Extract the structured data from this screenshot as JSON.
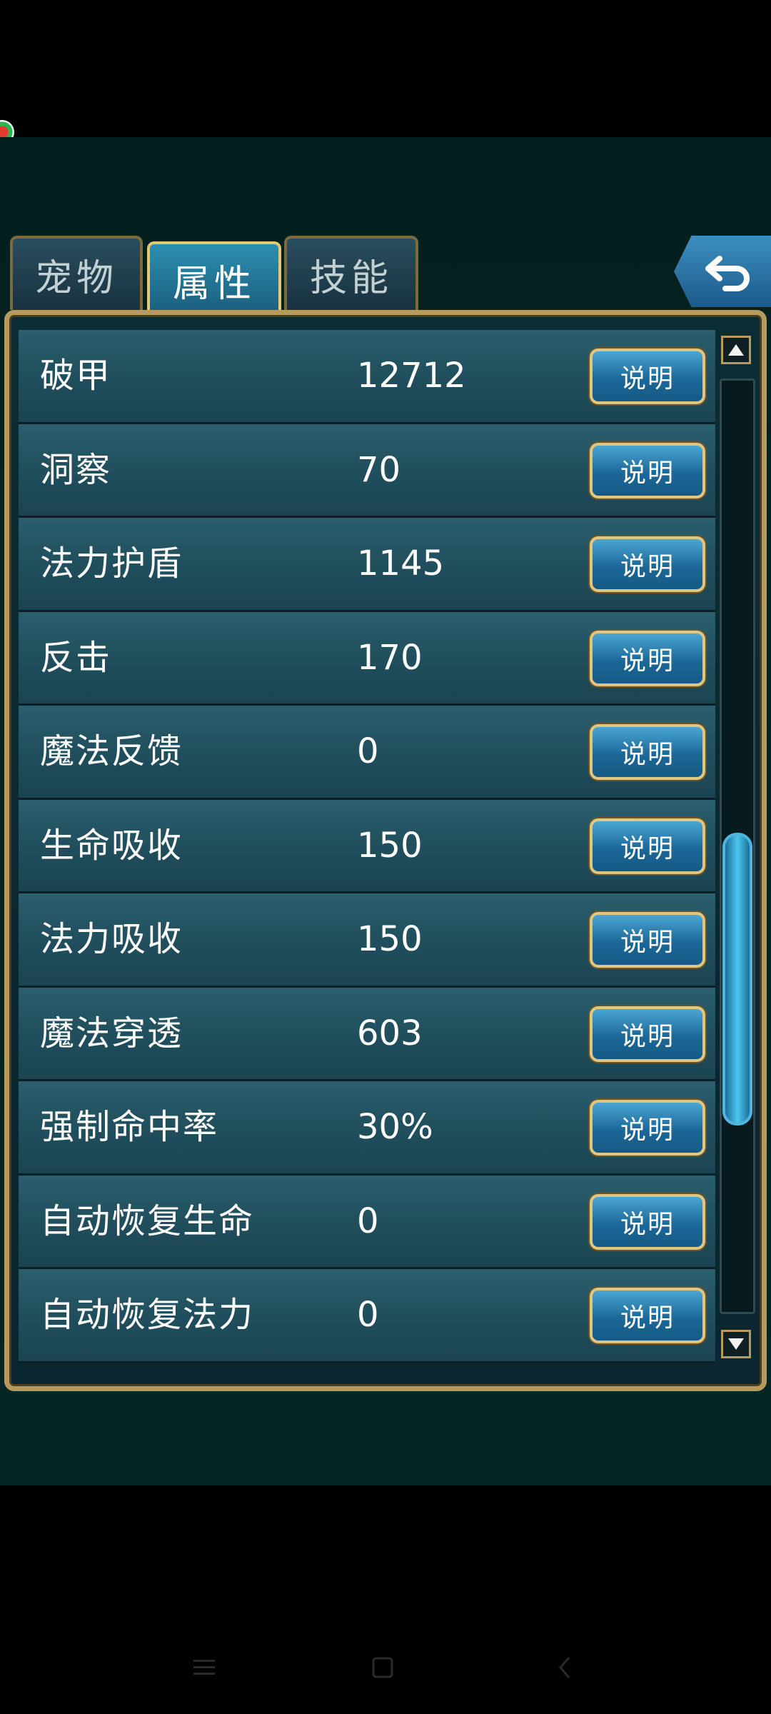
{
  "tabs": [
    {
      "label": "宠物"
    },
    {
      "label": "属性"
    },
    {
      "label": "技能"
    }
  ],
  "attributes": [
    {
      "name": "破甲",
      "value": "12712",
      "button": "说明"
    },
    {
      "name": "洞察",
      "value": "70",
      "button": "说明"
    },
    {
      "name": "法力护盾",
      "value": "1145",
      "button": "说明"
    },
    {
      "name": "反击",
      "value": "170",
      "button": "说明"
    },
    {
      "name": "魔法反馈",
      "value": "0",
      "button": "说明"
    },
    {
      "name": "生命吸收",
      "value": "150",
      "button": "说明"
    },
    {
      "name": "法力吸收",
      "value": "150",
      "button": "说明"
    },
    {
      "name": "魔法穿透",
      "value": "603",
      "button": "说明"
    },
    {
      "name": "强制命中率",
      "value": "30%",
      "button": "说明"
    },
    {
      "name": "自动恢复生命",
      "value": "0",
      "button": "说明"
    },
    {
      "name": "自动恢复法力",
      "value": "0",
      "button": "说明"
    }
  ],
  "icons": {
    "back": "back-arrow-icon",
    "scroll_up": "triangle-up-icon",
    "scroll_down": "triangle-down-icon"
  },
  "colors": {
    "panel_border": "#b79a5d",
    "active_tab": "#2d8fb0",
    "button": "#1c6898"
  }
}
